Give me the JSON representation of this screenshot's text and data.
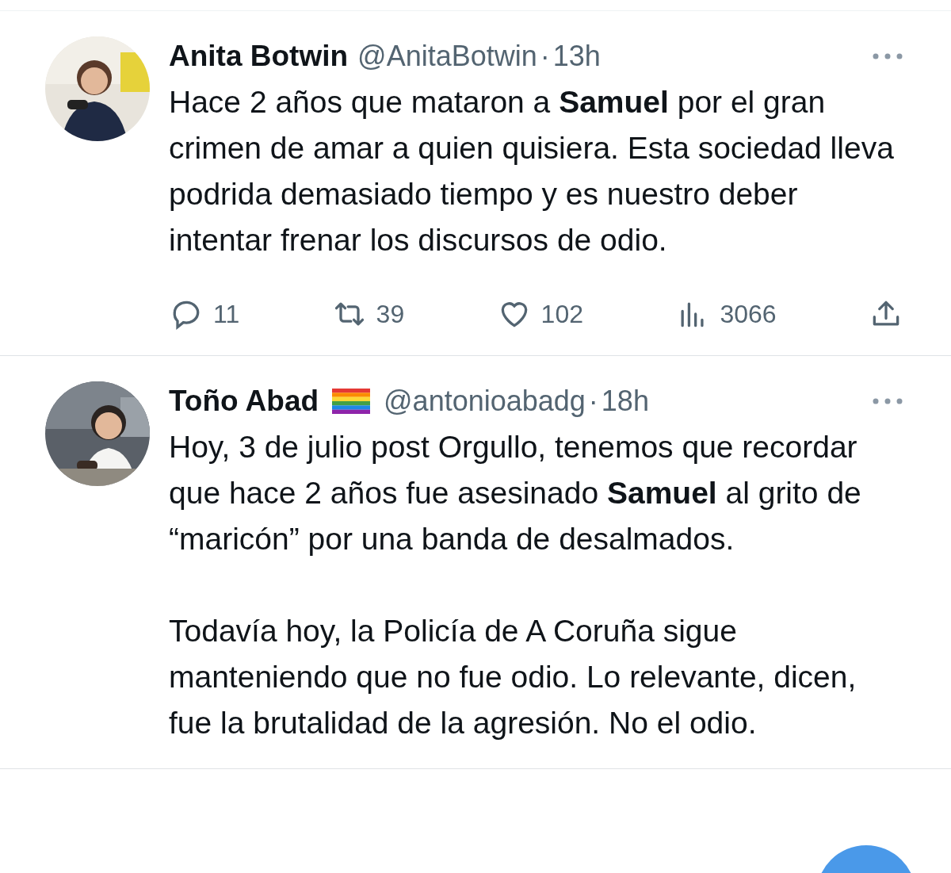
{
  "tweets": [
    {
      "name": "Anita Botwin",
      "kind": "plain",
      "handle": "@AnitaBotwin",
      "separator": "·",
      "time": "13h",
      "paragraphs": [
        "Hace 2 años que mataron a **Samuel** por el gran crimen de amar a quien quisiera. Esta sociedad lleva podrida demasiado tiempo y es nuestro deber intentar frenar los discursos de odio."
      ],
      "actions": {
        "replies": "11",
        "retweets": "39",
        "likes": "102",
        "views": "3066"
      }
    },
    {
      "name": "Toño Abad",
      "kind": "with_flag",
      "handle": "@antonioabadg",
      "separator": "·",
      "time": "18h",
      "paragraphs": [
        "Hoy, 3 de julio post Orgullo, tenemos que recordar que hace 2 años fue asesinado **Samuel** al grito de “maricón” por una banda de desalmados.",
        "Todavía hoy, la Policía de A Coruña sigue manteniendo que no fue odio. Lo relevante, dicen, fue la brutalidad de la agresión. No el odio."
      ]
    }
  ]
}
